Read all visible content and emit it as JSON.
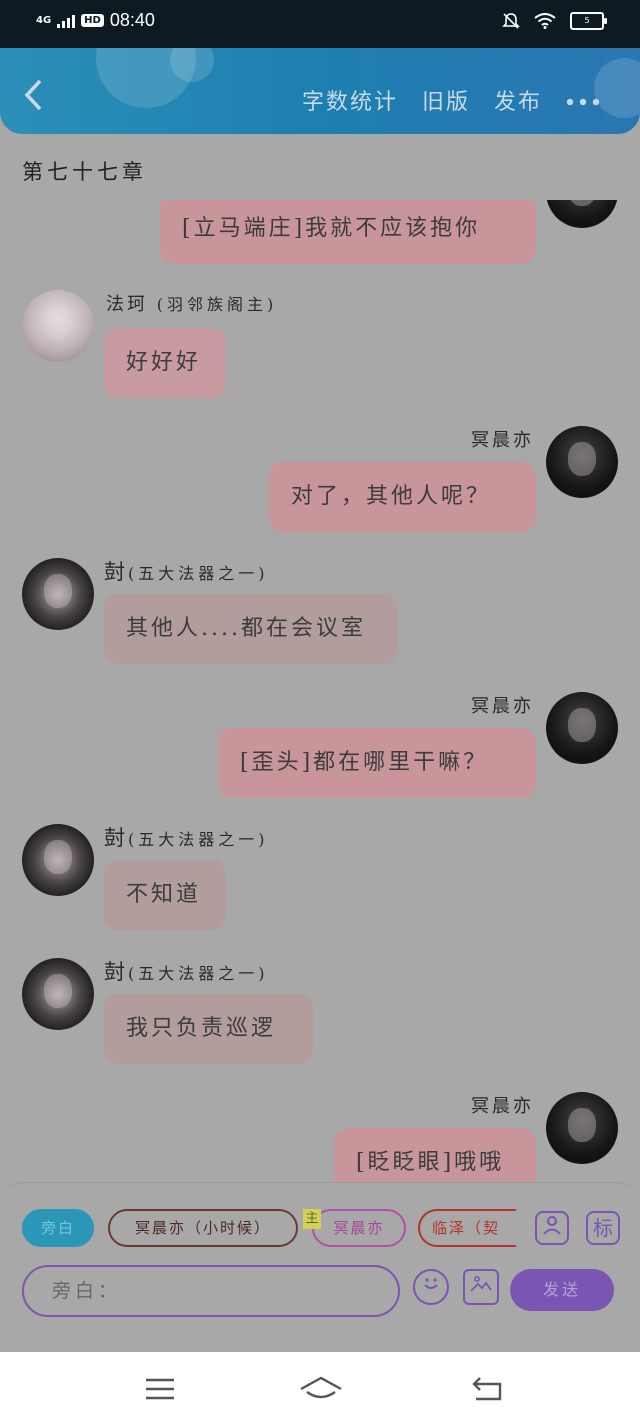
{
  "status": {
    "network": "4G",
    "hd": "HD",
    "time": "08:40",
    "battery": "5"
  },
  "header": {
    "back_icon": "chevron-left-icon",
    "actions": [
      "字数统计",
      "旧版",
      "发布"
    ],
    "more_icon": "more-dots-icon"
  },
  "chapter_title": "第七十七章",
  "messages": [
    {
      "side": "right",
      "text": "[立马端庄]我就不应该抱你",
      "avatar": "dark"
    },
    {
      "side": "left",
      "name": "法珂",
      "role": "(羽邻族阁主)",
      "text": "好好好",
      "avatar": "light"
    },
    {
      "side": "right",
      "name": "冥晨亦",
      "text": "对了，其他人呢？",
      "avatar": "dark"
    },
    {
      "side": "left",
      "name": "尌",
      "role": "(五大法器之一)",
      "text": "其他人....都在会议室",
      "avatar": "mixed"
    },
    {
      "side": "right",
      "name": "冥晨亦",
      "text": "[歪头]都在哪里干嘛？",
      "avatar": "dark"
    },
    {
      "side": "left",
      "name": "尌",
      "role": "(五大法器之一)",
      "text": "不知道",
      "avatar": "mixed"
    },
    {
      "side": "left",
      "name": "尌",
      "role": "(五大法器之一)",
      "text": "我只负责巡逻",
      "avatar": "mixed"
    },
    {
      "side": "right",
      "name": "冥晨亦",
      "text": "[眨眨眼]哦哦",
      "avatar": "dark"
    }
  ],
  "composer": {
    "chips": [
      "旁白",
      "冥晨亦（小时候）",
      "冥晨亦",
      "临泽（契"
    ],
    "main_tag": "主",
    "tools": [
      "role-icon",
      "标"
    ],
    "input_placeholder": "旁白：",
    "emoji_icon": "emoji-icon",
    "image_icon": "image-icon",
    "send_label": "发送"
  },
  "navbar": [
    "menu-icon",
    "home-icon",
    "back-icon"
  ]
}
